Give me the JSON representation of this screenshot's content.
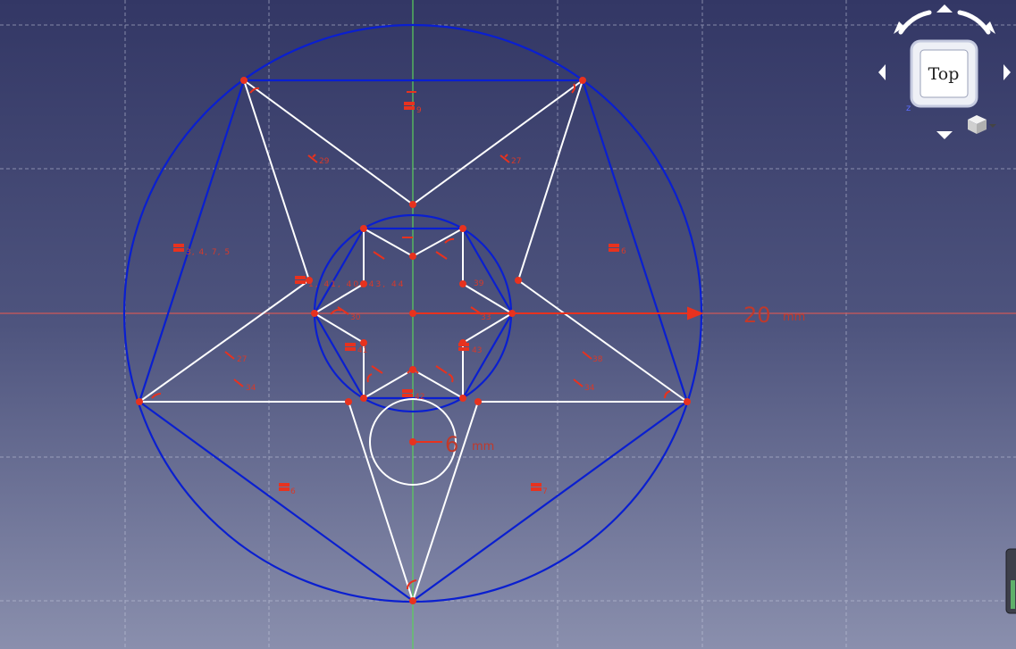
{
  "navcube": {
    "face_label": "Top",
    "axis_label": "z",
    "icons": [
      "rotate-left-arrow-icon",
      "rotate-right-arrow-icon",
      "arrow-up-icon",
      "arrow-down-icon",
      "arrow-left-icon",
      "arrow-right-icon",
      "view-menu-cube-icon"
    ]
  },
  "dimensions": {
    "outer_radius": {
      "value": "20",
      "unit": "mm"
    },
    "inner_radius": {
      "value": "6",
      "unit": "mm"
    }
  },
  "constraints": {
    "c_top": "9",
    "c_upper_left": "29",
    "c_upper_right": "27",
    "c_left_group": "3, 4, 7, 5",
    "c_right_e": "6",
    "c_center_row": "1, 41, 40, 43, 44",
    "c_center_left": "30",
    "c_center_right": "33",
    "c_inner_right": "39",
    "c_left_27": "27",
    "c_left_34": "34",
    "c_right_38": "38",
    "c_right_34": "34",
    "c_inner_l1": "41",
    "c_inner_r1": "43",
    "c_lower_center": "42",
    "c_bottom_left": "6",
    "c_bottom_right": "7"
  },
  "colors": {
    "construction": "#0a1fd0",
    "sketch": "#ffffff",
    "vertex": "#e8321e",
    "x_axis": "#d05858",
    "y_axis": "#5ad05a",
    "dimension": "#c0392b"
  }
}
